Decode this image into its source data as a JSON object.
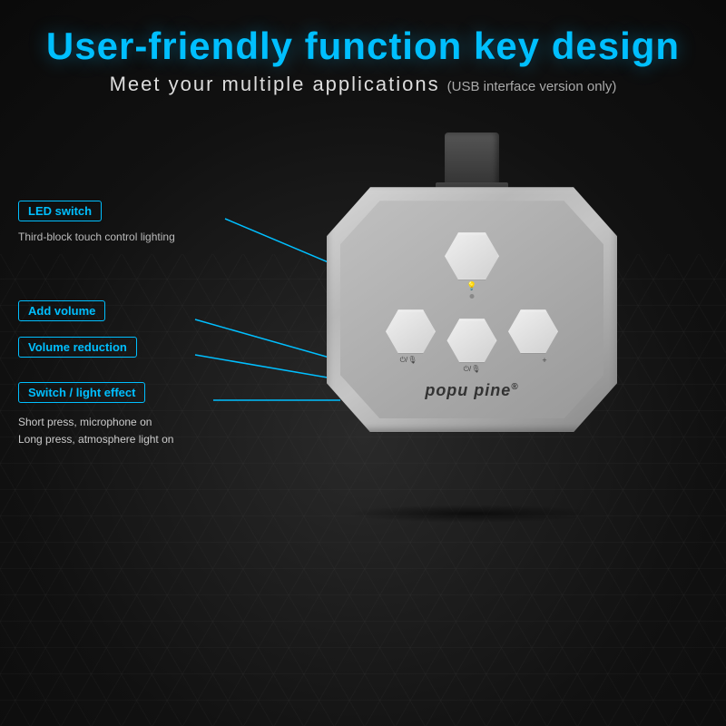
{
  "header": {
    "main_title": "User-friendly function key design",
    "subtitle_main": "Meet your multiple applications",
    "subtitle_note": "(USB interface version only)"
  },
  "callouts": {
    "led_switch": {
      "label": "LED switch",
      "description": "Third-block touch control lighting",
      "line_color": "#00bfff"
    },
    "add_volume": {
      "label": "Add volume",
      "line_color": "#00bfff"
    },
    "volume_reduction": {
      "label": "Volume reduction",
      "line_color": "#00bfff"
    },
    "switch_light": {
      "label": "Switch / light effect",
      "description_line1": "Short press, microphone on",
      "description_line2": "Long press, atmosphere light on",
      "line_color": "#00bfff"
    }
  },
  "device": {
    "brand": "popu pine",
    "brand_symbol": "®",
    "icon_top": "💡",
    "icon_ml": "⏻/🎙",
    "icon_mc": "⏻/🎙",
    "icon_mr": "+"
  },
  "colors": {
    "accent": "#00bfff",
    "background": "#111",
    "device_body": "#c0c0c0",
    "text_primary": "#ffffff",
    "text_secondary": "#cccccc"
  }
}
